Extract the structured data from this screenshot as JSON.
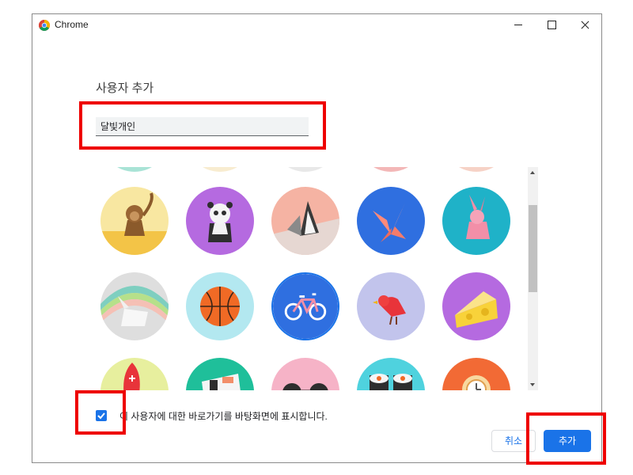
{
  "window": {
    "title": "Chrome"
  },
  "dialog": {
    "title": "사용자 추가",
    "name_value": "달빛개인",
    "checkbox_label": "이 사용자에 대한 바로가기를 바탕화면에 표시합니다.",
    "checkbox_checked": true,
    "cancel_label": "취소",
    "add_label": "추가"
  },
  "avatars": [
    "avatar-monkey",
    "avatar-panda",
    "avatar-penguin",
    "avatar-butterfly",
    "avatar-rabbit",
    "avatar-unicorn",
    "avatar-basketball",
    "avatar-bicycle",
    "avatar-bird",
    "avatar-cheese",
    "avatar-football",
    "avatar-sushi-plate",
    "avatar-sunglasses",
    "avatar-sushi-roll",
    "avatar-clock"
  ],
  "selected_avatar": "avatar-bicycle",
  "colors": {
    "accent": "#1a73e8",
    "highlight": "#ee0000"
  }
}
